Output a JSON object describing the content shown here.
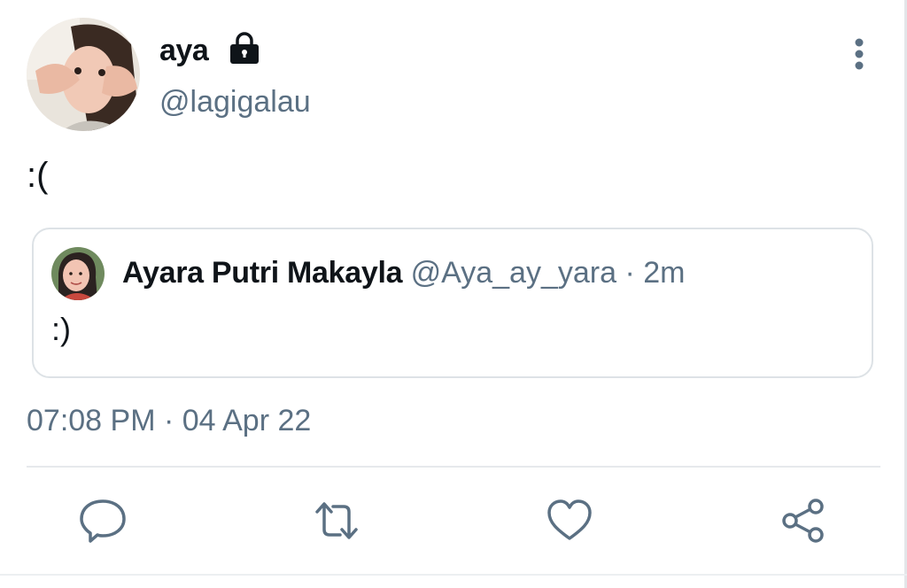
{
  "tweet": {
    "author": {
      "display_name": "aya",
      "handle": "@lagigalau",
      "avatar": "avatar-photo",
      "protected_icon": "lock-icon"
    },
    "text": ":(",
    "timestamp": "07:08 PM · 04 Apr 22",
    "more_icon": "more-vertical-icon"
  },
  "quoted_tweet": {
    "display_name": "Ayara Putri Makayla",
    "meta": " @Aya_ay_yara · 2m",
    "text": ":)"
  },
  "actions": [
    {
      "icon": "reply-icon"
    },
    {
      "icon": "retweet-icon"
    },
    {
      "icon": "like-icon"
    },
    {
      "icon": "share-icon"
    }
  ],
  "colors": {
    "text_primary": "#0f1419",
    "text_secondary": "#5b7083",
    "border": "#dde2e6"
  }
}
